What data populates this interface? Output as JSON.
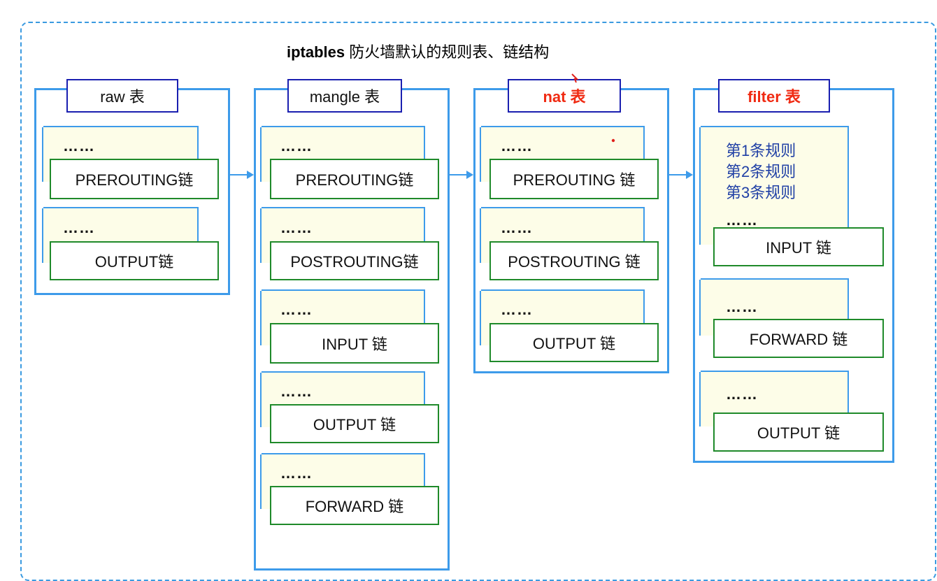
{
  "title": {
    "bold": "iptables",
    "rest": " 防火墙默认的规则表、链结构"
  },
  "tables": {
    "raw": {
      "label": "raw 表",
      "chains": [
        {
          "dots": "……",
          "label": "PREROUTING链"
        },
        {
          "dots": "……",
          "label": "OUTPUT链"
        }
      ]
    },
    "mangle": {
      "label": "mangle 表",
      "chains": [
        {
          "dots": "……",
          "label": "PREROUTING链"
        },
        {
          "dots": "……",
          "label": "POSTROUTING链"
        },
        {
          "dots": "……",
          "label": "INPUT 链"
        },
        {
          "dots": "……",
          "label": "OUTPUT 链"
        },
        {
          "dots": "……",
          "label": "FORWARD 链"
        }
      ]
    },
    "nat": {
      "label": "nat 表",
      "chains": [
        {
          "dots": "……",
          "label": "PREROUTING 链"
        },
        {
          "dots": "……",
          "label": "POSTROUTING 链"
        },
        {
          "dots": "……",
          "label": "OUTPUT 链"
        }
      ]
    },
    "filter": {
      "label": "filter 表",
      "rules": [
        "第1条规则",
        "第2条规则",
        "第3条规则"
      ],
      "chains": [
        {
          "dots": "……",
          "label": "INPUT 链"
        },
        {
          "dots": "……",
          "label": "FORWARD 链"
        },
        {
          "dots": "……",
          "label": "OUTPUT 链"
        }
      ]
    }
  },
  "colors": {
    "outer_border": "#3a9ae0",
    "table_border": "#3d9bea",
    "label_border": "#1a1fb0",
    "chain_border": "#1f8a2a",
    "rule_bg": "#fdfde8",
    "highlight_text": "#f02a12",
    "rule_text": "#1f3fa5"
  }
}
